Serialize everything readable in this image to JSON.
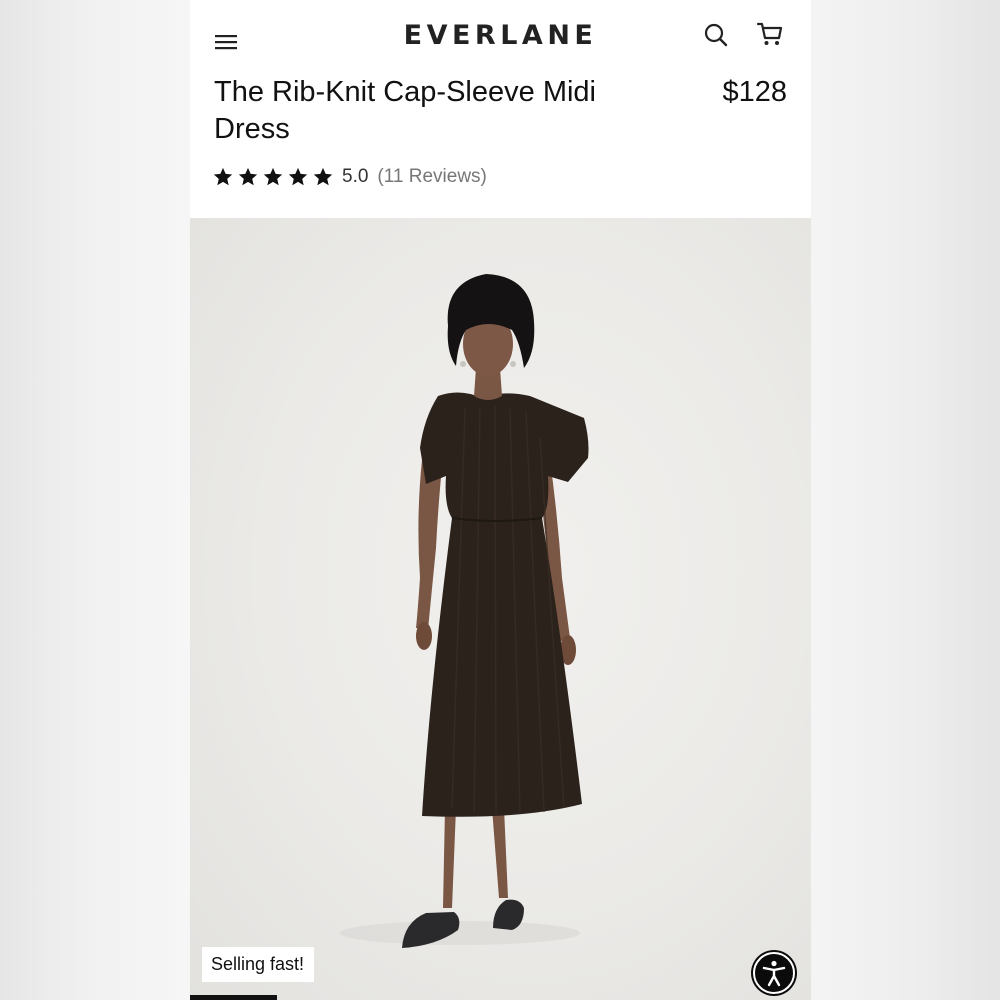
{
  "header": {
    "brand": "EVERLANE",
    "menu_icon": "hamburger-menu-icon",
    "search_icon": "search-icon",
    "cart_icon": "shopping-cart-icon"
  },
  "product": {
    "title": "The Rib-Knit Cap-Sleeve Midi Dress",
    "price": "$128",
    "rating": {
      "stars": 5,
      "max_stars": 5,
      "value": "5.0",
      "reviews": "(11 Reviews)"
    }
  },
  "gallery": {
    "badge": "Selling fast!",
    "progress": 0.14
  },
  "accessibility_button": {
    "icon": "accessibility-icon"
  },
  "colors": {
    "text": "#111111",
    "muted": "#777777",
    "dress": "#2b221c",
    "background": "#ebeae7"
  }
}
